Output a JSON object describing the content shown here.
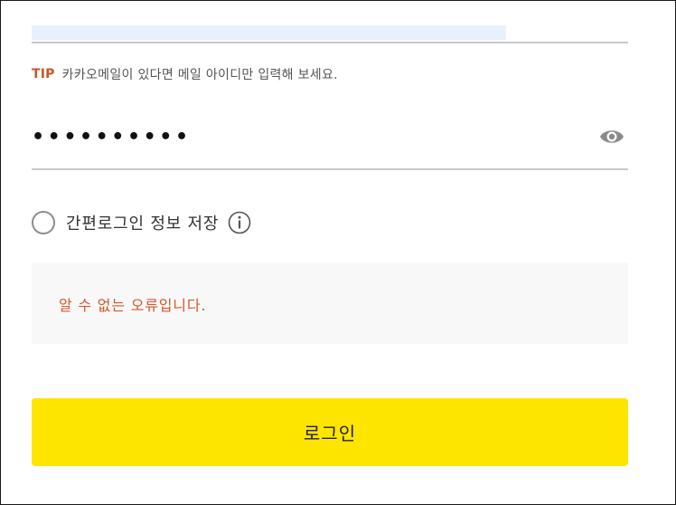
{
  "tip": {
    "label": "TIP",
    "text": "카카오메일이 있다면 메일 아이디만 입력해 보세요."
  },
  "password": {
    "value_masked": "••••••••••",
    "reveal_icon": "eye-icon"
  },
  "keep_login": {
    "label": "간편로그인 정보 저장",
    "checked": false,
    "info_icon": "info-icon"
  },
  "error": {
    "message": "알 수 없는 오류입니다."
  },
  "login_button": {
    "label": "로그인"
  },
  "colors": {
    "accent_yellow": "#fee500",
    "error_red": "#d4572e",
    "tip_orange": "#c9552d",
    "field_underline": "#c9c9c9",
    "autofill_blue": "#e8f0fe"
  }
}
